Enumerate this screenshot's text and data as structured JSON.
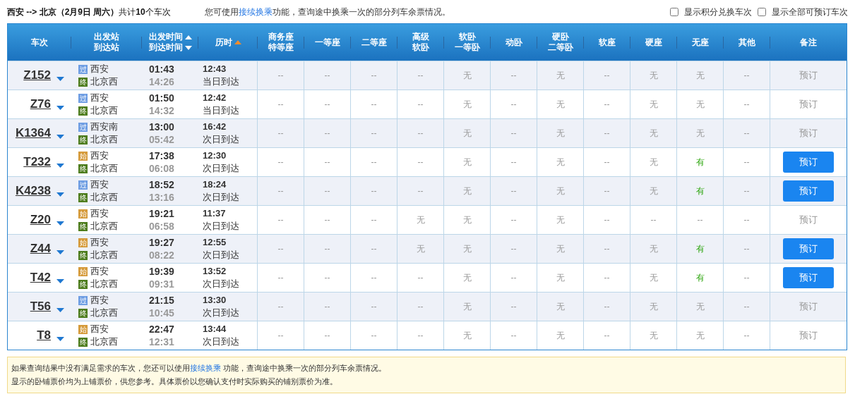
{
  "summary": "**西安 --> 北京（2月9日  周六）**共计**10**个车次",
  "tip": {
    "before": "您可使用",
    "link": "接续换乘",
    "after": "功能，查询途中换乘一次的部分列车余票情况。"
  },
  "options": [
    {
      "label": "显示积分兑换车次",
      "checked": false
    },
    {
      "label": "显示全部可预订车次",
      "checked": false
    }
  ],
  "columns": [
    {
      "lines": [
        "车次"
      ]
    },
    {
      "lines": [
        "出发站",
        "到达站"
      ]
    },
    {
      "lines": [
        "出发时间",
        "到达时间"
      ],
      "sort_arrows": [
        {
          "kind": "up",
          "active": false
        },
        {
          "kind": "down",
          "active": false
        }
      ]
    },
    {
      "lines": [
        "历时"
      ],
      "sort_arrows": [
        {
          "kind": "up",
          "active": true
        }
      ]
    },
    {
      "lines": [
        "商务座",
        "特等座"
      ]
    },
    {
      "lines": [
        "一等座"
      ]
    },
    {
      "lines": [
        "二等座"
      ]
    },
    {
      "lines": [
        "高级",
        "软卧"
      ]
    },
    {
      "lines": [
        "软卧",
        "一等卧"
      ]
    },
    {
      "lines": [
        "动卧"
      ]
    },
    {
      "lines": [
        "硬卧",
        "二等卧"
      ]
    },
    {
      "lines": [
        "软座"
      ]
    },
    {
      "lines": [
        "硬座"
      ]
    },
    {
      "lines": [
        "无座"
      ]
    },
    {
      "lines": [
        "其他"
      ]
    },
    {
      "lines": [
        "备注"
      ]
    }
  ],
  "rows": [
    {
      "train": "Z152",
      "from": {
        "badge": "过",
        "kind": "pass",
        "name": "西安"
      },
      "to": {
        "badge": "终",
        "kind": "end",
        "name": "北京西"
      },
      "depart": "01:43",
      "arrive": "14:26",
      "duration": "12:43",
      "arrival_day": "当日到达",
      "seats": [
        {
          "text": "--",
          "available": false
        },
        {
          "text": "--",
          "available": false
        },
        {
          "text": "--",
          "available": false
        },
        {
          "text": "--",
          "available": false
        },
        {
          "text": "无",
          "available": false
        },
        {
          "text": "--",
          "available": false
        },
        {
          "text": "无",
          "available": false
        },
        {
          "text": "--",
          "available": false
        },
        {
          "text": "无",
          "available": false
        },
        {
          "text": "无",
          "available": false
        },
        {
          "text": "--",
          "available": false
        }
      ],
      "book": {
        "label": "预订",
        "enabled": false
      }
    },
    {
      "train": "Z76",
      "from": {
        "badge": "过",
        "kind": "pass",
        "name": "西安"
      },
      "to": {
        "badge": "终",
        "kind": "end",
        "name": "北京西"
      },
      "depart": "01:50",
      "arrive": "14:32",
      "duration": "12:42",
      "arrival_day": "当日到达",
      "seats": [
        {
          "text": "--",
          "available": false
        },
        {
          "text": "--",
          "available": false
        },
        {
          "text": "--",
          "available": false
        },
        {
          "text": "--",
          "available": false
        },
        {
          "text": "无",
          "available": false
        },
        {
          "text": "--",
          "available": false
        },
        {
          "text": "无",
          "available": false
        },
        {
          "text": "--",
          "available": false
        },
        {
          "text": "无",
          "available": false
        },
        {
          "text": "无",
          "available": false
        },
        {
          "text": "--",
          "available": false
        }
      ],
      "book": {
        "label": "预订",
        "enabled": false
      }
    },
    {
      "train": "K1364",
      "from": {
        "badge": "过",
        "kind": "pass",
        "name": "西安南"
      },
      "to": {
        "badge": "终",
        "kind": "end",
        "name": "北京西"
      },
      "depart": "13:00",
      "arrive": "05:42",
      "duration": "16:42",
      "arrival_day": "次日到达",
      "seats": [
        {
          "text": "--",
          "available": false
        },
        {
          "text": "--",
          "available": false
        },
        {
          "text": "--",
          "available": false
        },
        {
          "text": "--",
          "available": false
        },
        {
          "text": "无",
          "available": false
        },
        {
          "text": "--",
          "available": false
        },
        {
          "text": "无",
          "available": false
        },
        {
          "text": "--",
          "available": false
        },
        {
          "text": "无",
          "available": false
        },
        {
          "text": "无",
          "available": false
        },
        {
          "text": "--",
          "available": false
        }
      ],
      "book": {
        "label": "预订",
        "enabled": false
      }
    },
    {
      "train": "T232",
      "from": {
        "badge": "始",
        "kind": "start",
        "name": "西安"
      },
      "to": {
        "badge": "终",
        "kind": "end",
        "name": "北京西"
      },
      "depart": "17:38",
      "arrive": "06:08",
      "duration": "12:30",
      "arrival_day": "次日到达",
      "seats": [
        {
          "text": "--",
          "available": false
        },
        {
          "text": "--",
          "available": false
        },
        {
          "text": "--",
          "available": false
        },
        {
          "text": "--",
          "available": false
        },
        {
          "text": "无",
          "available": false
        },
        {
          "text": "--",
          "available": false
        },
        {
          "text": "无",
          "available": false
        },
        {
          "text": "--",
          "available": false
        },
        {
          "text": "无",
          "available": false
        },
        {
          "text": "有",
          "available": true
        },
        {
          "text": "--",
          "available": false
        }
      ],
      "book": {
        "label": "预订",
        "enabled": true
      }
    },
    {
      "train": "K4238",
      "from": {
        "badge": "过",
        "kind": "pass",
        "name": "西安"
      },
      "to": {
        "badge": "终",
        "kind": "end",
        "name": "北京西"
      },
      "depart": "18:52",
      "arrive": "13:16",
      "duration": "18:24",
      "arrival_day": "次日到达",
      "seats": [
        {
          "text": "--",
          "available": false
        },
        {
          "text": "--",
          "available": false
        },
        {
          "text": "--",
          "available": false
        },
        {
          "text": "--",
          "available": false
        },
        {
          "text": "无",
          "available": false
        },
        {
          "text": "--",
          "available": false
        },
        {
          "text": "无",
          "available": false
        },
        {
          "text": "--",
          "available": false
        },
        {
          "text": "无",
          "available": false
        },
        {
          "text": "有",
          "available": true
        },
        {
          "text": "--",
          "available": false
        }
      ],
      "book": {
        "label": "预订",
        "enabled": true
      }
    },
    {
      "train": "Z20",
      "from": {
        "badge": "始",
        "kind": "start",
        "name": "西安"
      },
      "to": {
        "badge": "终",
        "kind": "end",
        "name": "北京西"
      },
      "depart": "19:21",
      "arrive": "06:58",
      "duration": "11:37",
      "arrival_day": "次日到达",
      "seats": [
        {
          "text": "--",
          "available": false
        },
        {
          "text": "--",
          "available": false
        },
        {
          "text": "--",
          "available": false
        },
        {
          "text": "无",
          "available": false
        },
        {
          "text": "无",
          "available": false
        },
        {
          "text": "--",
          "available": false
        },
        {
          "text": "无",
          "available": false
        },
        {
          "text": "--",
          "available": false
        },
        {
          "text": "--",
          "available": false
        },
        {
          "text": "--",
          "available": false
        },
        {
          "text": "--",
          "available": false
        }
      ],
      "book": {
        "label": "预订",
        "enabled": false
      }
    },
    {
      "train": "Z44",
      "from": {
        "badge": "始",
        "kind": "start",
        "name": "西安"
      },
      "to": {
        "badge": "终",
        "kind": "end",
        "name": "北京西"
      },
      "depart": "19:27",
      "arrive": "08:22",
      "duration": "12:55",
      "arrival_day": "次日到达",
      "seats": [
        {
          "text": "--",
          "available": false
        },
        {
          "text": "--",
          "available": false
        },
        {
          "text": "--",
          "available": false
        },
        {
          "text": "无",
          "available": false
        },
        {
          "text": "无",
          "available": false
        },
        {
          "text": "--",
          "available": false
        },
        {
          "text": "无",
          "available": false
        },
        {
          "text": "--",
          "available": false
        },
        {
          "text": "无",
          "available": false
        },
        {
          "text": "有",
          "available": true
        },
        {
          "text": "--",
          "available": false
        }
      ],
      "book": {
        "label": "预订",
        "enabled": true
      }
    },
    {
      "train": "T42",
      "from": {
        "badge": "始",
        "kind": "start",
        "name": "西安"
      },
      "to": {
        "badge": "终",
        "kind": "end",
        "name": "北京西"
      },
      "depart": "19:39",
      "arrive": "09:31",
      "duration": "13:52",
      "arrival_day": "次日到达",
      "seats": [
        {
          "text": "--",
          "available": false
        },
        {
          "text": "--",
          "available": false
        },
        {
          "text": "--",
          "available": false
        },
        {
          "text": "--",
          "available": false
        },
        {
          "text": "无",
          "available": false
        },
        {
          "text": "--",
          "available": false
        },
        {
          "text": "无",
          "available": false
        },
        {
          "text": "--",
          "available": false
        },
        {
          "text": "无",
          "available": false
        },
        {
          "text": "有",
          "available": true
        },
        {
          "text": "--",
          "available": false
        }
      ],
      "book": {
        "label": "预订",
        "enabled": true
      }
    },
    {
      "train": "T56",
      "from": {
        "badge": "过",
        "kind": "pass",
        "name": "西安"
      },
      "to": {
        "badge": "终",
        "kind": "end",
        "name": "北京西"
      },
      "depart": "21:15",
      "arrive": "10:45",
      "duration": "13:30",
      "arrival_day": "次日到达",
      "seats": [
        {
          "text": "--",
          "available": false
        },
        {
          "text": "--",
          "available": false
        },
        {
          "text": "--",
          "available": false
        },
        {
          "text": "--",
          "available": false
        },
        {
          "text": "无",
          "available": false
        },
        {
          "text": "--",
          "available": false
        },
        {
          "text": "无",
          "available": false
        },
        {
          "text": "--",
          "available": false
        },
        {
          "text": "无",
          "available": false
        },
        {
          "text": "无",
          "available": false
        },
        {
          "text": "--",
          "available": false
        }
      ],
      "book": {
        "label": "预订",
        "enabled": false
      }
    },
    {
      "train": "T8",
      "from": {
        "badge": "始",
        "kind": "start",
        "name": "西安"
      },
      "to": {
        "badge": "终",
        "kind": "end",
        "name": "北京西"
      },
      "depart": "22:47",
      "arrive": "12:31",
      "duration": "13:44",
      "arrival_day": "次日到达",
      "seats": [
        {
          "text": "--",
          "available": false
        },
        {
          "text": "--",
          "available": false
        },
        {
          "text": "--",
          "available": false
        },
        {
          "text": "--",
          "available": false
        },
        {
          "text": "无",
          "available": false
        },
        {
          "text": "--",
          "available": false
        },
        {
          "text": "无",
          "available": false
        },
        {
          "text": "--",
          "available": false
        },
        {
          "text": "无",
          "available": false
        },
        {
          "text": "无",
          "available": false
        },
        {
          "text": "--",
          "available": false
        }
      ],
      "book": {
        "label": "预订",
        "enabled": false
      }
    }
  ],
  "notice": [
    {
      "before": "如果查询结果中没有满足需求的车次，您还可以使用",
      "link": "接续换乘",
      "after": " 功能，查询途中换乘一次的部分列车余票情况。"
    },
    {
      "before": "显示的卧铺票价均为上铺票价，供您参考。具体票价以您确认支付时实际购买的铺别票价为准。"
    }
  ]
}
